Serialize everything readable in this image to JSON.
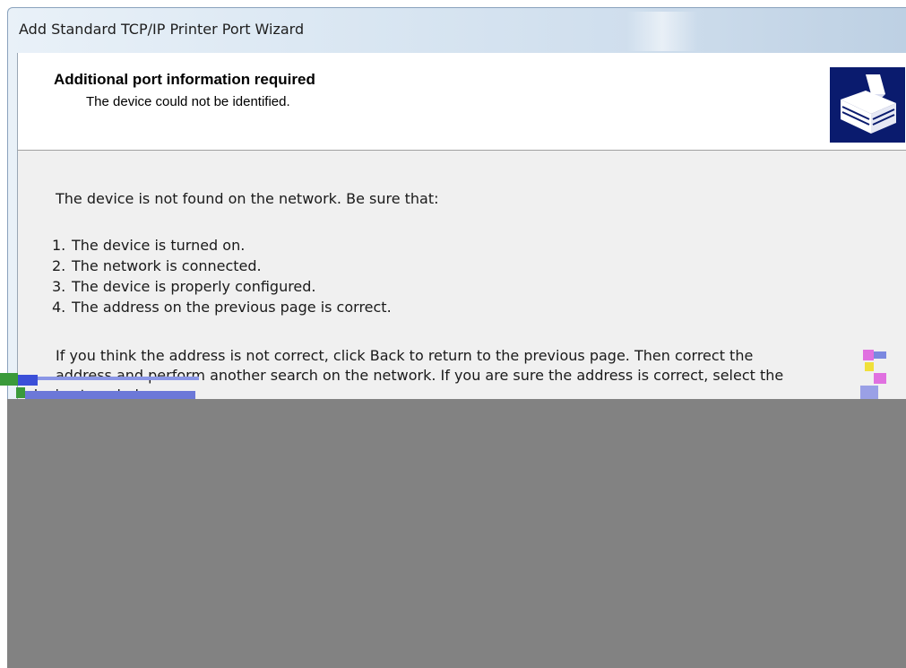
{
  "window": {
    "title": "Add Standard TCP/IP Printer Port Wizard"
  },
  "header": {
    "title": "Additional port information required",
    "subtitle": "The device could not be identified.",
    "logo_icon": "printer-wizard-icon",
    "logo_color": "#0a1b6e"
  },
  "body": {
    "intro": "The device is not found on the network.  Be sure that:",
    "checklist": [
      {
        "num": "1.",
        "text": "The device is turned on."
      },
      {
        "num": "2.",
        "text": "The network is connected."
      },
      {
        "num": "3.",
        "text": "The device is properly configured."
      },
      {
        "num": "4.",
        "text": "The address on the previous page is correct."
      }
    ],
    "paragraph_line1": "If you think the address is not correct, click Back to return to the previous page.  Then correct the",
    "paragraph_line2": "address and perform another search on the network.  If you are sure the address is correct, select the",
    "paragraph_line3": "device type below."
  },
  "colors": {
    "corrupted_area": "#828282",
    "body_background": "#f0f0f0"
  }
}
